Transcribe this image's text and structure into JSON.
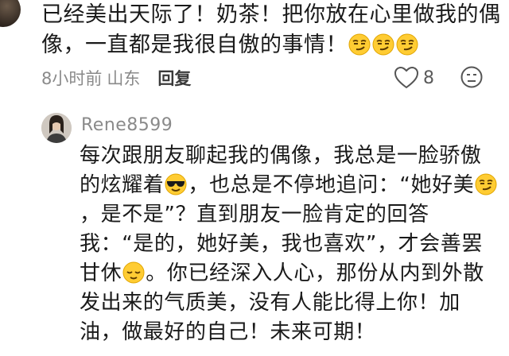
{
  "comment1": {
    "text_part1": "已经美出天际了！奶茶！把你放在心里做我的偶像，一直都是我很自傲的事情！",
    "emoji": [
      "smirk-emoji",
      "smirk-emoji",
      "smirk-emoji"
    ],
    "time": "8小时前",
    "location": "山东",
    "reply_label": "回复",
    "like_count": "8"
  },
  "comment2": {
    "username": "Rene8599",
    "text_seg1": "每次跟朋友聊起我的偶像，我总是一脸骄傲的炫耀着",
    "text_seg2": "，也总是不停地追问：“她好美",
    "text_seg3": "，是不是”？直到朋友一脸肯定的回答我：“是的，她好美，我也喜欢”，才会善罢甘休",
    "text_seg4": "。你已经深入人心，那份从内到外散发出来的气质美，没有人能比得上你！加油，做最好的自己！未来可期！",
    "emoji": [
      "sunglasses-emoji",
      "smirk-emoji",
      "relieved-emoji"
    ]
  },
  "colors": {
    "text": "#1a1a1a",
    "meta": "#8a8a8a",
    "emoji_face": "#ffcc33",
    "emoji_edge": "#e0a500"
  }
}
